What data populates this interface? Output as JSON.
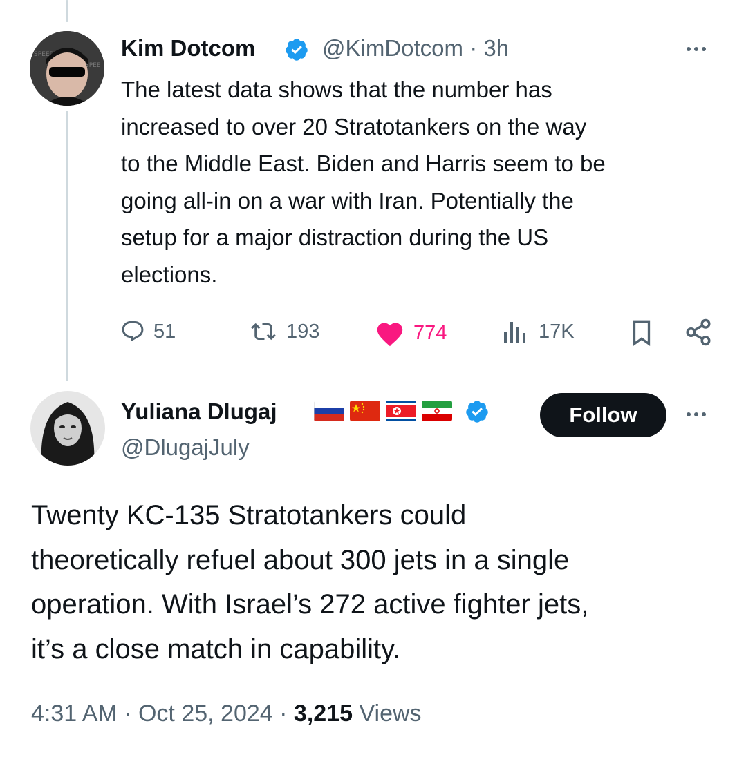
{
  "tweet1": {
    "name": "Kim Dotcom",
    "handle": "@KimDotcom",
    "separator": "·",
    "time": "3h",
    "text_lines": [
      "The latest data shows that the number has",
      "increased to over 20 Stratotankers on the way",
      "to the Middle East. Biden and Harris seem to be",
      "going all-in on a war with Iran. Potentially the",
      "setup for a major distraction during the US",
      "elections."
    ],
    "replies": "51",
    "retweets": "193",
    "likes": "774",
    "views": "17K"
  },
  "tweet2": {
    "name": "Yuliana Dlugaj",
    "handle": "@DlugajJuly",
    "follow_label": "Follow",
    "flags": [
      "russia-flag",
      "china-flag",
      "north-korea-flag",
      "iran-flag"
    ],
    "text_lines": [
      "Twenty KC-135 Stratotankers could",
      "theoretically refuel about 300 jets in a single",
      "operation. With Israel’s 272 active fighter jets,",
      "it’s a close match in capability."
    ],
    "time": "4:31 AM",
    "date": "Oct 25, 2024",
    "separator": "·",
    "views_count": "3,215",
    "views_label": "Views"
  },
  "colors": {
    "like": "#f91880",
    "verified": "#1d9bf0",
    "muted": "#536471",
    "text": "#0f1419"
  }
}
